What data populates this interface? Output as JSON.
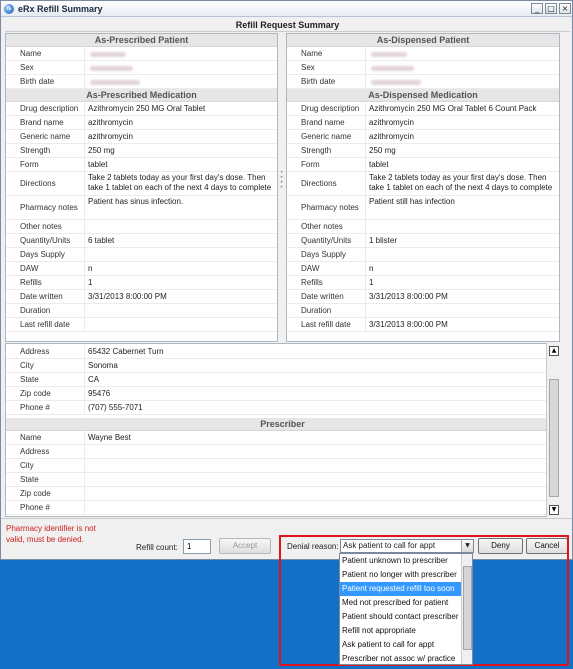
{
  "window": {
    "title": "eRx Refill Summary",
    "minimize": "_",
    "maximize": "□",
    "close": "×"
  },
  "summary_title": "Refill Request Summary",
  "left": {
    "patient_header": "As-Prescribed Patient",
    "med_header": "As-Prescribed Medication",
    "patient": [
      {
        "label": "Name",
        "value": ""
      },
      {
        "label": "Sex",
        "value": ""
      },
      {
        "label": "Birth date",
        "value": ""
      }
    ],
    "medication": [
      {
        "label": "Drug description",
        "value": "Azithromycin 250 MG Oral Tablet"
      },
      {
        "label": "Brand name",
        "value": "azithromycin"
      },
      {
        "label": "Generic name",
        "value": "azithromycin"
      },
      {
        "label": "Strength",
        "value": "250 mg"
      },
      {
        "label": "Form",
        "value": "tablet"
      },
      {
        "label": "Directions",
        "value": "Take 2 tablets today as your first day's dose. Then take 1 tablet on each of the next 4 days to complete"
      },
      {
        "label": "Pharmacy notes",
        "value": "Patient has sinus infection."
      },
      {
        "label": "Other notes",
        "value": ""
      },
      {
        "label": "Quantity/Units",
        "value": "6 tablet"
      },
      {
        "label": "Days Supply",
        "value": ""
      },
      {
        "label": "DAW",
        "value": "n"
      },
      {
        "label": "Refills",
        "value": "1"
      },
      {
        "label": "Date written",
        "value": "3/31/2013 8:00:00 PM"
      },
      {
        "label": "Duration",
        "value": ""
      },
      {
        "label": "Last refill date",
        "value": ""
      }
    ]
  },
  "right": {
    "patient_header": "As-Dispensed Patient",
    "med_header": "As-Dispensed Medication",
    "patient": [
      {
        "label": "Name",
        "value": ""
      },
      {
        "label": "Sex",
        "value": ""
      },
      {
        "label": "Birth date",
        "value": ""
      }
    ],
    "medication": [
      {
        "label": "Drug description",
        "value": "Azithromycin 250 MG Oral Tablet 6 Count Pack"
      },
      {
        "label": "Brand name",
        "value": "azithromycin"
      },
      {
        "label": "Generic name",
        "value": "azithromycin"
      },
      {
        "label": "Strength",
        "value": "250 mg"
      },
      {
        "label": "Form",
        "value": "tablet"
      },
      {
        "label": "Directions",
        "value": "Take 2 tablets today as your first day's dose. Then take 1 tablet on each of the next 4 days to complete"
      },
      {
        "label": "Pharmacy notes",
        "value": "Patient still has infection"
      },
      {
        "label": "Other notes",
        "value": ""
      },
      {
        "label": "Quantity/Units",
        "value": "1 blister"
      },
      {
        "label": "Days Supply",
        "value": ""
      },
      {
        "label": "DAW",
        "value": "n"
      },
      {
        "label": "Refills",
        "value": "1"
      },
      {
        "label": "Date written",
        "value": "3/31/2013 8:00:00 PM"
      },
      {
        "label": "Duration",
        "value": ""
      },
      {
        "label": "Last refill date",
        "value": "3/31/2013 8:00:00 PM"
      }
    ]
  },
  "bottom": {
    "pharmacy": [
      {
        "label": "Address",
        "value": "65432 Cabernet Turn"
      },
      {
        "label": "City",
        "value": "Sonoma"
      },
      {
        "label": "State",
        "value": "CA"
      },
      {
        "label": "Zip code",
        "value": "95476"
      },
      {
        "label": "Phone #",
        "value": "(707) 555-7071"
      }
    ],
    "prescriber_header": "Prescriber",
    "prescriber": [
      {
        "label": "Name",
        "value": "Wayne Best"
      },
      {
        "label": "Address",
        "value": ""
      },
      {
        "label": "City",
        "value": ""
      },
      {
        "label": "State",
        "value": ""
      },
      {
        "label": "Zip code",
        "value": ""
      },
      {
        "label": "Phone #",
        "value": ""
      }
    ]
  },
  "footer": {
    "error": "Pharmacy identifier is not valid, must be denied.",
    "refill_count_label": "Refill count:",
    "refill_count_value": "1",
    "accept_label": "Accept",
    "denial_reason_label": "Denial reason:",
    "denial_reason_value": "Ask patient to call for appt",
    "deny_label": "Deny",
    "cancel_label": "Cancel"
  },
  "denial_options": [
    {
      "label": "Patient unknown to prescriber",
      "selected": false
    },
    {
      "label": "Patient no longer with prescriber",
      "selected": false
    },
    {
      "label": "Patient requested refill too soon",
      "selected": true
    },
    {
      "label": "Med not prescribed for patient",
      "selected": false
    },
    {
      "label": "Patient should contact prescriber",
      "selected": false
    },
    {
      "label": "Refill not appropriate",
      "selected": false
    },
    {
      "label": "Ask patient to call for appt",
      "selected": false
    },
    {
      "label": "Prescriber not assoc w/ practice",
      "selected": false
    }
  ],
  "colors": {
    "desktop": "#1270c8",
    "highlight_border": "#e0141e",
    "selected_option": "#3399ff",
    "error_text": "#d22020"
  }
}
